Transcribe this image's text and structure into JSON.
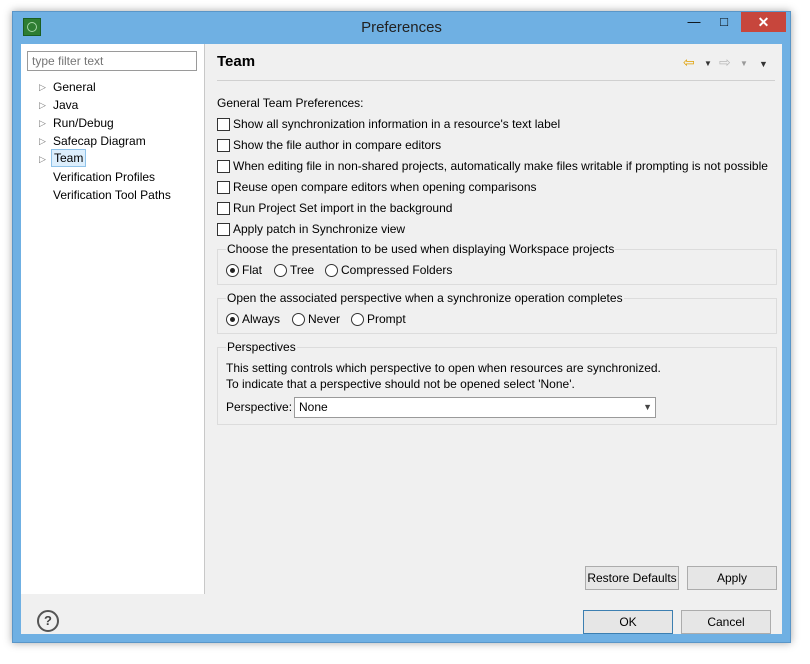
{
  "window": {
    "title": "Preferences",
    "minimize": "—",
    "maximize": "□",
    "close": "✕"
  },
  "filter": {
    "placeholder": "type filter text"
  },
  "tree": [
    {
      "label": "General",
      "expandable": true
    },
    {
      "label": "Java",
      "expandable": true
    },
    {
      "label": "Run/Debug",
      "expandable": true
    },
    {
      "label": "Safecap Diagram",
      "expandable": true
    },
    {
      "label": "Team",
      "expandable": true,
      "selected": true
    },
    {
      "label": "Verification Profiles",
      "expandable": false
    },
    {
      "label": "Verification Tool Paths",
      "expandable": false
    }
  ],
  "page": {
    "title": "Team",
    "section_heading": "General Team Preferences:",
    "checkboxes": [
      "Show all synchronization information in a resource's text label",
      "Show the file author in compare editors",
      "When editing file in non-shared projects, automatically make files writable if prompting is not possible",
      "Reuse open compare editors when opening comparisons",
      "Run Project Set import in the background",
      "Apply patch in Synchronize view"
    ],
    "presentation": {
      "label": "Choose the presentation to be used when displaying Workspace projects",
      "options": [
        "Flat",
        "Tree",
        "Compressed Folders"
      ],
      "selected": "Flat"
    },
    "perspective_open": {
      "label": "Open the associated perspective when a synchronize operation completes",
      "options": [
        "Always",
        "Never",
        "Prompt"
      ],
      "selected": "Always"
    },
    "perspectives": {
      "label": "Perspectives",
      "desc1": "This setting controls which perspective to open when resources are synchronized.",
      "desc2": "To indicate that a perspective should not be opened select 'None'.",
      "field_label": "Perspective:",
      "value": "None"
    },
    "restore_defaults": "Restore Defaults",
    "apply": "Apply"
  },
  "buttons": {
    "ok": "OK",
    "cancel": "Cancel",
    "help": "?"
  },
  "icons": {
    "back": "⇦",
    "forward": "⇨",
    "dropdown": "▼",
    "menu": "▼",
    "tree_arrow": "▷",
    "select_arrow": "⌄"
  },
  "colors": {
    "titlebar": "#6fb0e3",
    "close": "#c7463c",
    "selection": "#dceefc"
  }
}
